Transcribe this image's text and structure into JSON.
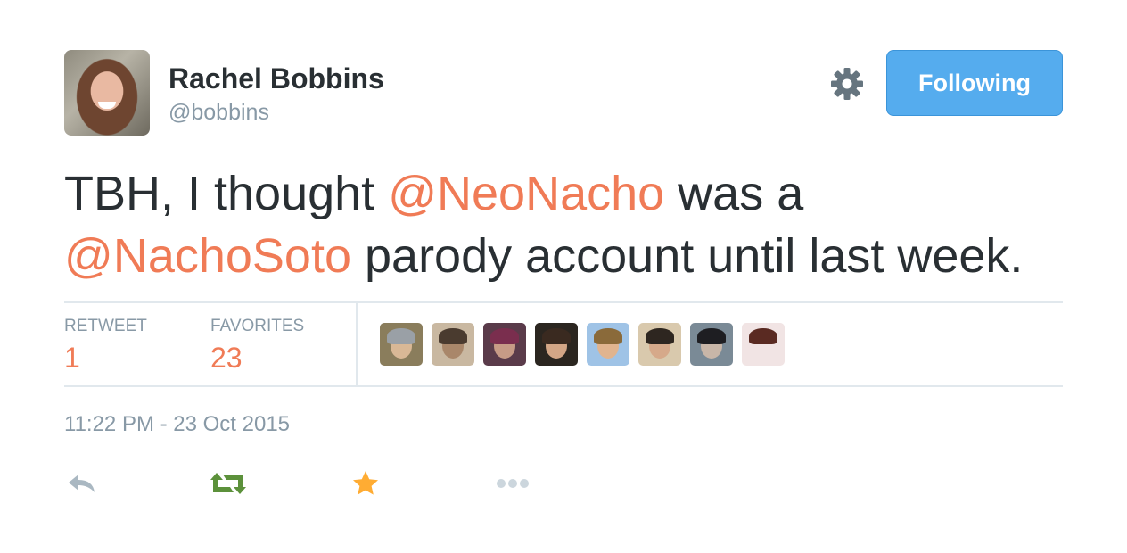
{
  "user": {
    "name": "Rachel Bobbins",
    "handle": "@bobbins",
    "avatar_icon": "user-avatar"
  },
  "header": {
    "settings_icon": "gear-icon",
    "follow_label": "Following",
    "follow_color": "#55acee"
  },
  "tweet": {
    "segments": [
      {
        "text": "TBH, I thought ",
        "mention": false
      },
      {
        "text": "@NeoNacho",
        "mention": true
      },
      {
        "text": " was a ",
        "mention": false
      },
      {
        "text": "@NachoSoto",
        "mention": true
      },
      {
        "text": " parody account until last week.",
        "mention": false
      }
    ],
    "mention_color": "#f07b56"
  },
  "stats": {
    "retweet_label": "RETWEET",
    "retweet_count": "1",
    "favorites_label": "FAVORITES",
    "favorites_count": "23",
    "favoriter_avatars": [
      "favoriter-avatar-1",
      "favoriter-avatar-2",
      "favoriter-avatar-3",
      "favoriter-avatar-4",
      "favoriter-avatar-5",
      "favoriter-avatar-6",
      "favoriter-avatar-7",
      "favoriter-avatar-8"
    ]
  },
  "timestamp": "11:22 PM - 23 Oct 2015",
  "actions": [
    {
      "icon": "reply-icon",
      "color": "#aab8c2"
    },
    {
      "icon": "retweet-icon",
      "color": "#5c913b"
    },
    {
      "icon": "star-icon",
      "color": "#ffac33"
    },
    {
      "icon": "more-icon",
      "color": "#ccd6dd"
    }
  ]
}
